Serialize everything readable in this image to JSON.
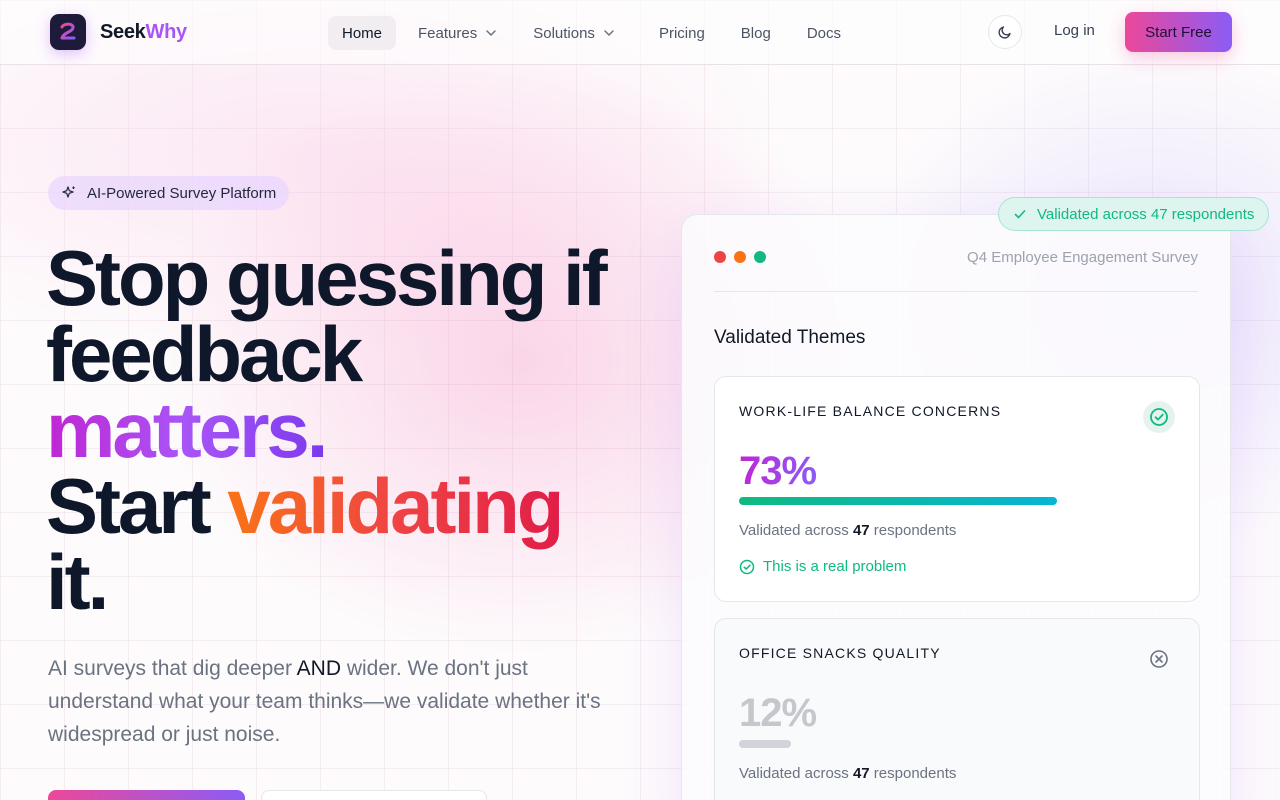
{
  "brand": {
    "seek": "Seek",
    "why": "Why"
  },
  "nav": {
    "items": [
      {
        "label": "Home"
      },
      {
        "label": "Features"
      },
      {
        "label": "Solutions"
      },
      {
        "label": "Pricing"
      },
      {
        "label": "Blog"
      },
      {
        "label": "Docs"
      }
    ],
    "login": "Log in",
    "cta": "Start Free"
  },
  "hero": {
    "badge": "AI-Powered Survey Platform",
    "line1": "Stop guessing if",
    "line2": "feedback",
    "line3": "matters.",
    "line4a": "Start ",
    "line4b": "validating",
    "line5": "it.",
    "sub_a": "AI surveys that dig deeper ",
    "sub_b": "AND",
    "sub_c": " wider. We don't just understand what your team thinks—we validate whether it's widespread or just noise."
  },
  "panel": {
    "title": "Q4 Employee Engagement Survey",
    "floating_badge": "Validated across 47 respondents",
    "heading": "Validated Themes",
    "themes": [
      {
        "name": "WORK-LIFE BALANCE CONCERNS",
        "pct": "73%",
        "fill": 0.73,
        "meta_a": "Validated across ",
        "meta_b": "47",
        "meta_c": " respondents",
        "verdict": "This is a real problem"
      },
      {
        "name": "OFFICE SNACKS QUALITY",
        "pct": "12%",
        "fill": 0.12,
        "meta_a": "Validated across ",
        "meta_b": "47",
        "meta_c": " respondents"
      }
    ]
  },
  "colors": {
    "accent_pink": "#ec4899",
    "accent_purple": "#8b5cf6",
    "success": "#10b981"
  }
}
